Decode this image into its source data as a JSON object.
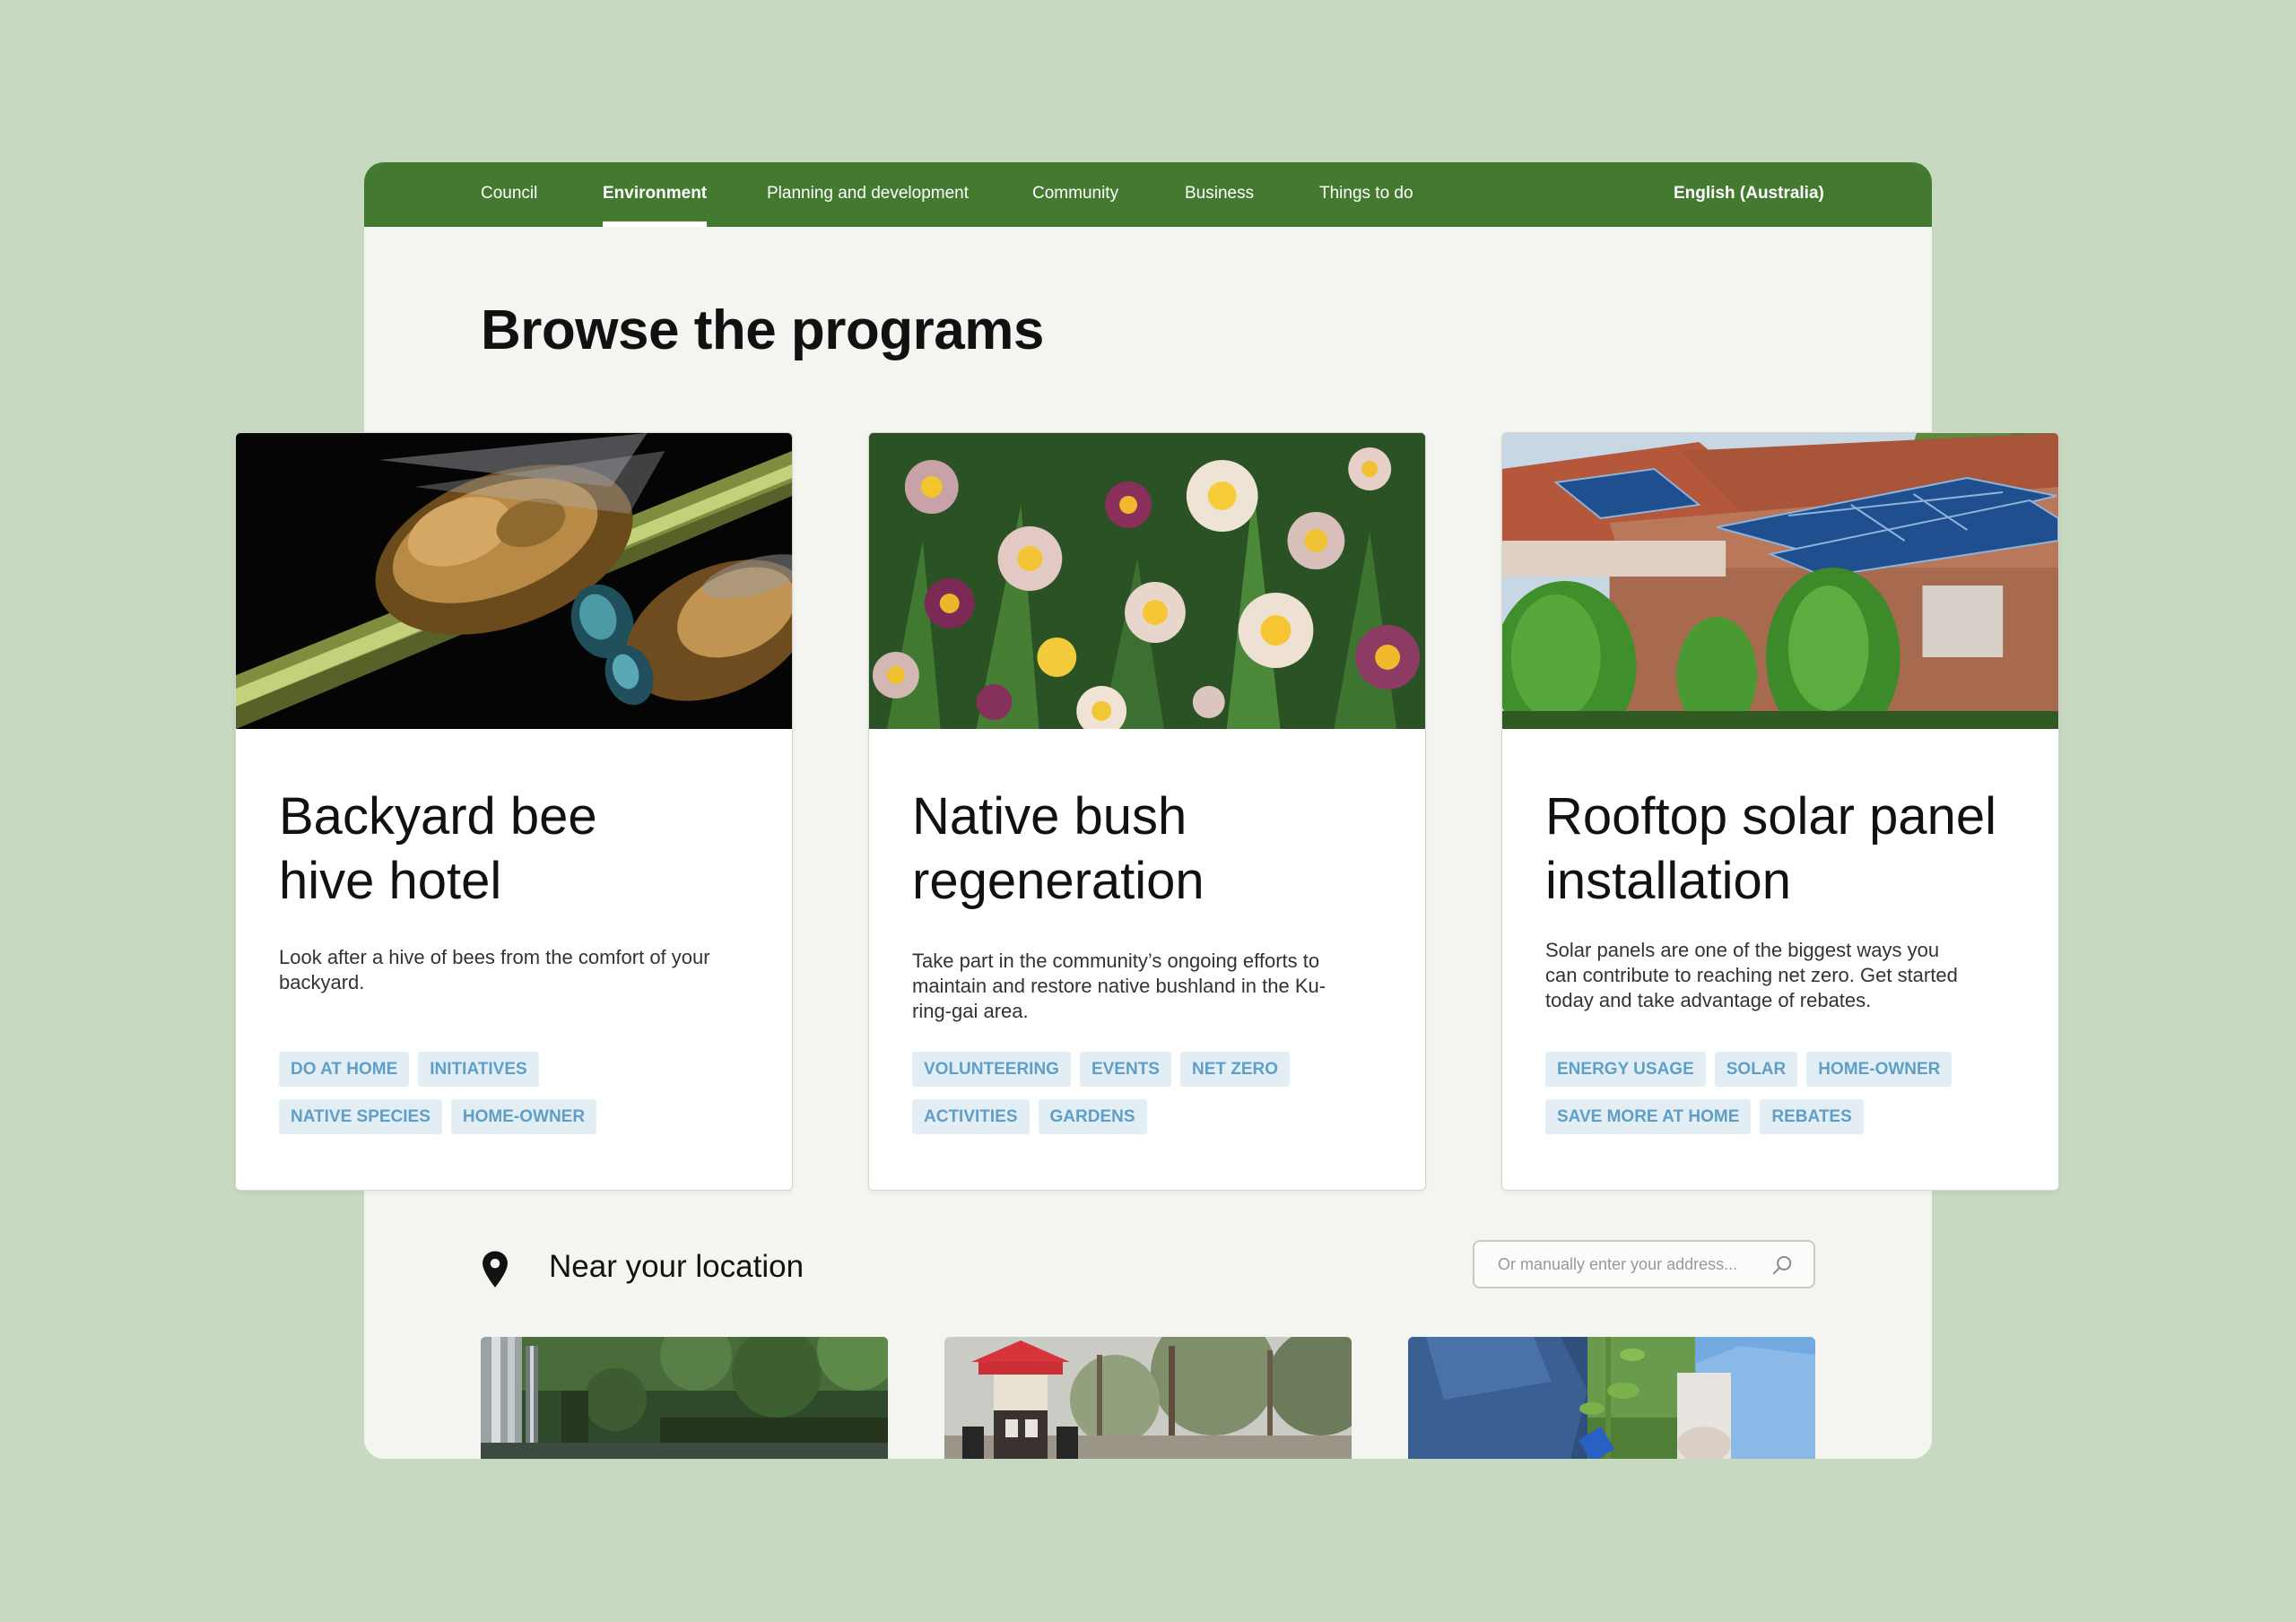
{
  "nav": {
    "items": [
      {
        "label": "Council",
        "active": false
      },
      {
        "label": "Environment",
        "active": true
      },
      {
        "label": "Planning and development",
        "active": false
      },
      {
        "label": "Community",
        "active": false
      },
      {
        "label": "Business",
        "active": false
      },
      {
        "label": "Things to do",
        "active": false
      }
    ],
    "language": "English (Australia)"
  },
  "page_title": "Browse the programs",
  "cards": [
    {
      "title_line1": "Backyard bee",
      "title_line2": "hive hotel",
      "description": "Look after a hive of bees from the comfort of your backyard.",
      "image": "bees-on-stem-photo",
      "tags": [
        "DO AT HOME",
        "INITIATIVES",
        "NATIVE SPECIES",
        "HOME-OWNER"
      ]
    },
    {
      "title_line1": "Native bush",
      "title_line2": "regeneration",
      "description": "Take part in the community’s ongoing efforts to maintain and restore native bushland in the Ku-ring-gai area.",
      "image": "paper-daisies-photo",
      "tags": [
        "VOLUNTEERING",
        "EVENTS",
        "NET ZERO",
        "ACTIVITIES",
        "GARDENS"
      ]
    },
    {
      "title_line1": "Rooftop solar panel",
      "title_line2": "installation",
      "description": "Solar panels are one of the biggest ways you can contribute to reaching net zero. Get started today and take advantage of rebates.",
      "image": "rooftop-solar-photo",
      "tags": [
        "ENERGY USAGE",
        "SOLAR",
        "HOME-OWNER",
        "SAVE MORE AT HOME",
        "REBATES"
      ]
    }
  ],
  "near": {
    "title": "Near your location",
    "icon": "location-pin-icon",
    "address_placeholder": "Or manually enter your address...",
    "search_icon": "search-icon"
  },
  "thumbnails": [
    "waterfall-photo",
    "playground-photo",
    "tree-planting-photo"
  ],
  "colors": {
    "background": "#c7d9c1",
    "nav": "#437a30",
    "tag_bg": "#e3eef4",
    "tag_text": "#5f9fc7"
  }
}
